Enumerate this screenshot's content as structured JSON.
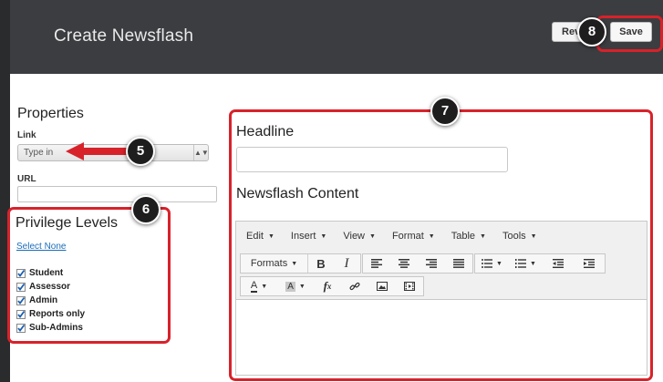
{
  "header": {
    "title": "Create Newsflash",
    "revert_label": "Revert",
    "save_label": "Save"
  },
  "markers": {
    "m5": "5",
    "m6": "6",
    "m7": "7",
    "m8": "8"
  },
  "properties": {
    "heading": "Properties",
    "link_label": "Link",
    "link_value": "Type in",
    "url_label": "URL",
    "url_value": ""
  },
  "privileges": {
    "heading": "Privilege Levels",
    "select_none": "Select None",
    "roles": [
      {
        "label": "Student",
        "checked": true
      },
      {
        "label": "Assessor",
        "checked": true
      },
      {
        "label": "Admin",
        "checked": true
      },
      {
        "label": "Reports only",
        "checked": true
      },
      {
        "label": "Sub-Admins",
        "checked": true
      }
    ]
  },
  "editor_section": {
    "headline_label": "Headline",
    "headline_value": "",
    "content_label": "Newsflash Content",
    "menu": [
      "Edit",
      "Insert",
      "View",
      "Format",
      "Table",
      "Tools"
    ],
    "formats_label": "Formats"
  },
  "colors": {
    "header_bg": "#3b3d40",
    "highlight_red": "#d8222a",
    "link_blue": "#1a6dba"
  }
}
